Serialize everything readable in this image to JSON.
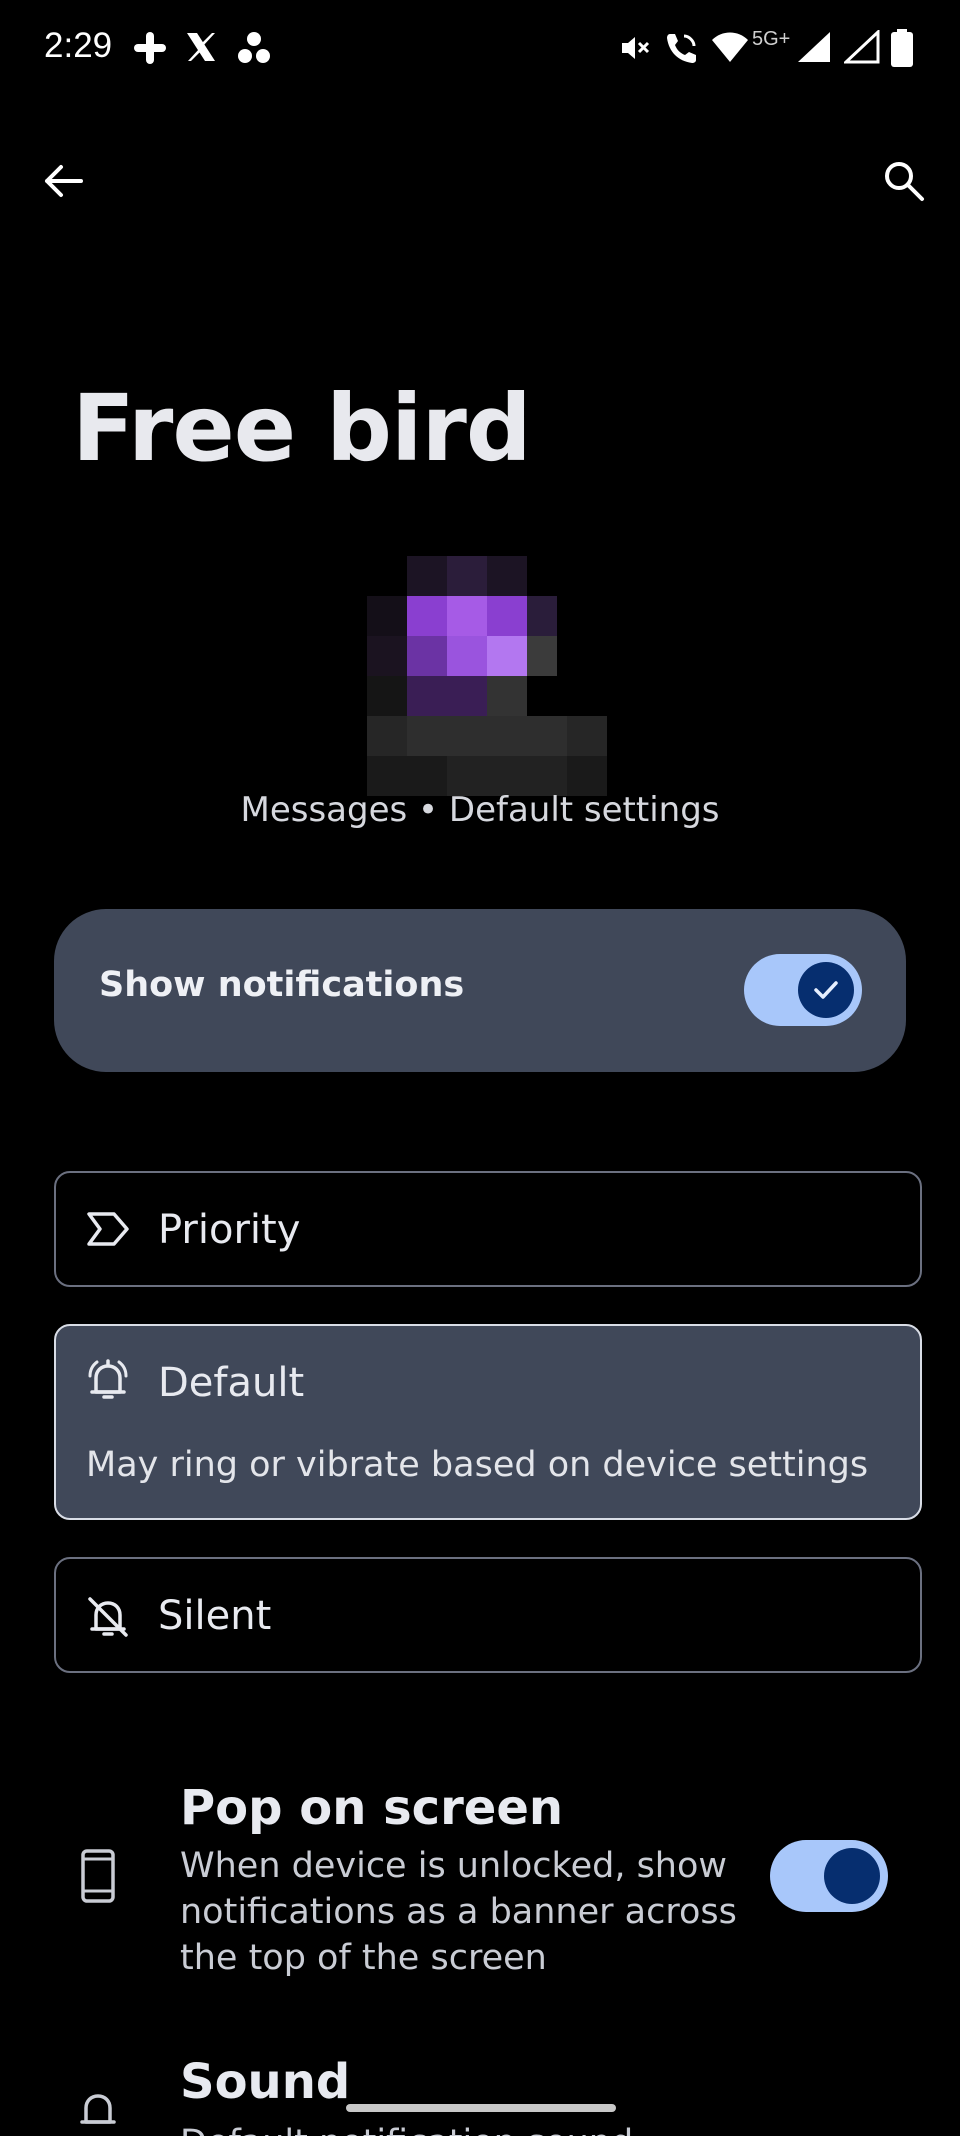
{
  "status_bar": {
    "time": "2:29",
    "network_label": "5G+"
  },
  "header": {
    "title": "Free bird",
    "subtitle": "Messages • Default settings"
  },
  "show_notifications": {
    "label": "Show notifications",
    "enabled": true
  },
  "options": {
    "priority": {
      "label": "Priority"
    },
    "default": {
      "label": "Default",
      "description": "May ring or vibrate based on device settings"
    },
    "silent": {
      "label": "Silent"
    }
  },
  "pop_on_screen": {
    "title": "Pop on screen",
    "description": "When device is unlocked, show notifications as a banner across the top of the screen",
    "enabled": true
  },
  "sound": {
    "title": "Sound",
    "description_partial": "Default notification sound"
  },
  "colors": {
    "accent_track": "#a8c7fa",
    "accent_knob": "#062e6f",
    "card_bg": "#404859"
  }
}
